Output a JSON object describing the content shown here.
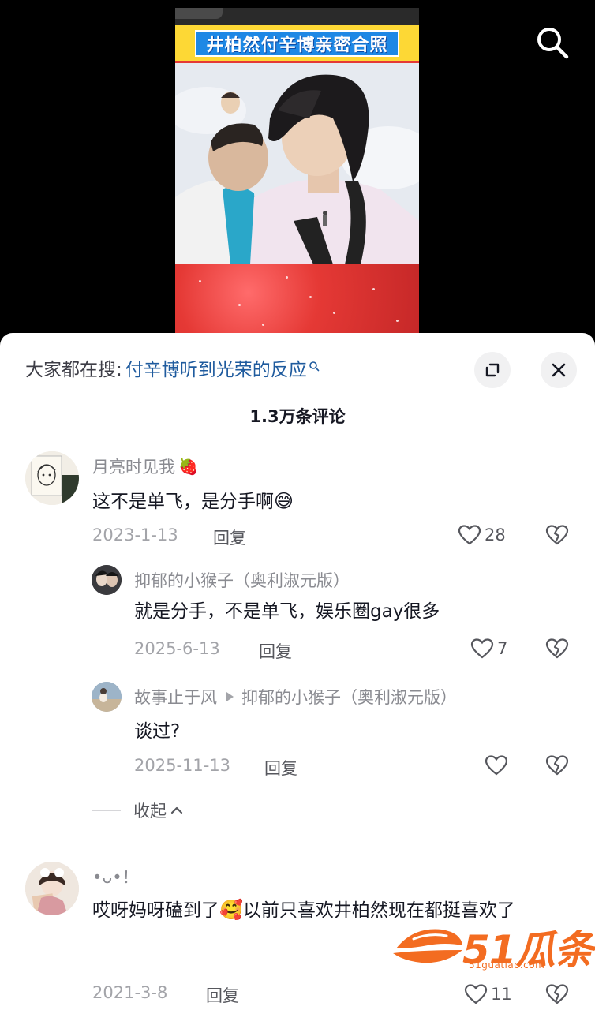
{
  "video": {
    "banner_text": "井柏然付辛博亲密合照"
  },
  "search_suggestion": {
    "prefix": "大家都在搜:",
    "query": "付辛博听到光荣的反应"
  },
  "comments_header": {
    "count_label": "1.3万条评论"
  },
  "comments": [
    {
      "username": "月亮时见我",
      "username_emoji": "🍓",
      "text": "这不是单飞，是分手啊",
      "text_emoji": "😅",
      "date": "2023-1-13",
      "reply_label": "回复",
      "likes": "28"
    },
    {
      "username": "•ᴗ•！",
      "text_before_emoji": "哎呀妈呀磕到了",
      "text_emoji": "🥰",
      "text_after_emoji": "以前只喜欢井柏然现在都挺喜欢了",
      "date": "2021-3-8",
      "reply_label": "回复",
      "likes": "11"
    }
  ],
  "replies": [
    {
      "username": "抑郁的小猴子（奥利淑元版）",
      "text": "就是分手，不是单飞，娱乐圈gay很多",
      "date": "2025-6-13",
      "reply_label": "回复",
      "likes": "7"
    },
    {
      "username": "故事止于风",
      "reply_to": "抑郁的小猴子（奥利淑元版）",
      "text": "谈过?",
      "date": "2025-11-13",
      "reply_label": "回复",
      "likes": ""
    }
  ],
  "collapse_label": "收起",
  "watermark": {
    "brand": "51瓜条",
    "url": "51guatiao.com"
  },
  "colors": {
    "link_blue": "#1f5b9e",
    "watermark_orange": "#f36c21",
    "banner_yellow": "#fdd835",
    "banner_blue": "#1e88e5"
  }
}
